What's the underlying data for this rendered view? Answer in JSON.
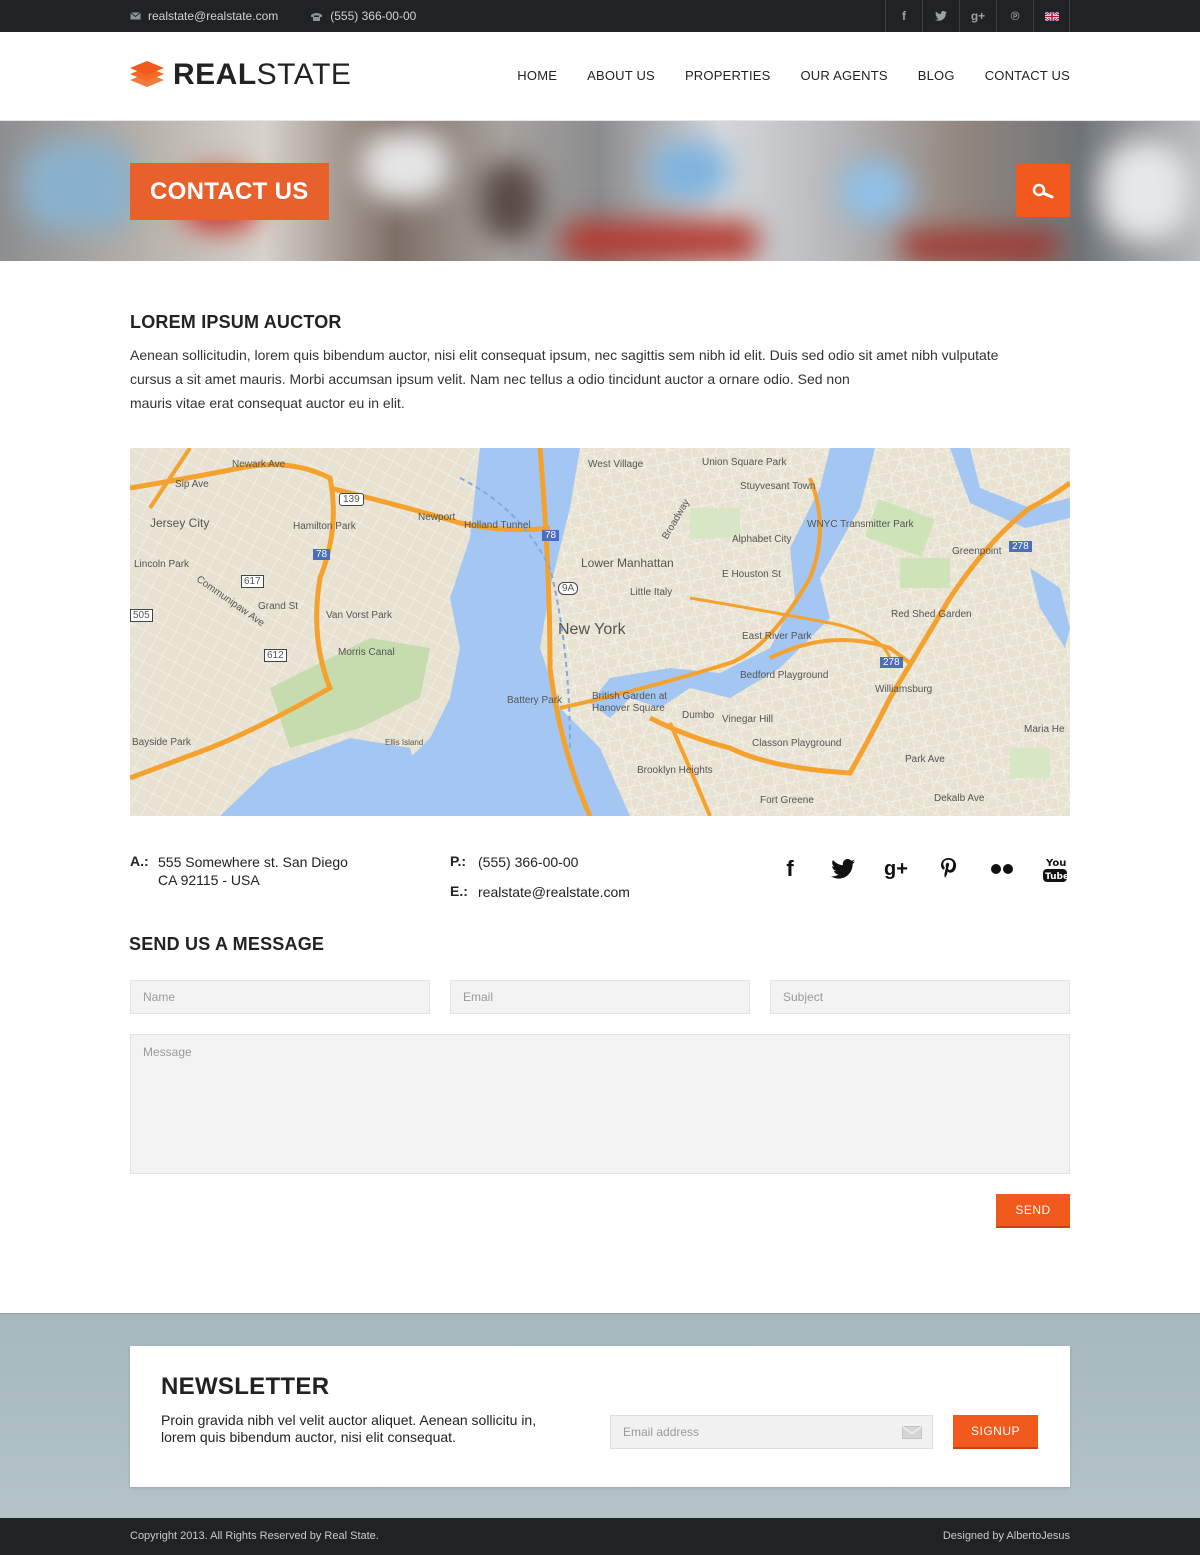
{
  "topbar": {
    "email": "realstate@realstate.com",
    "phone": "(555) 366-00-00",
    "social_icons": [
      "facebook-icon",
      "twitter-icon",
      "google-plus-icon",
      "pinterest-icon",
      "uk-flag-icon"
    ]
  },
  "header": {
    "logo_bold": "REAL",
    "logo_light": "STATE",
    "nav": [
      "HOME",
      "ABOUT US",
      "PROPERTIES",
      "OUR AGENTS",
      "BLOG",
      "CONTACT US"
    ]
  },
  "hero": {
    "title": "CONTACT US"
  },
  "intro": {
    "title": "LOREM IPSUM AUCTOR",
    "text_line1": "Aenean sollicitudin, lorem quis bibendum auctor, nisi elit consequat ipsum, nec sagittis sem nibh id elit. Duis sed odio sit amet nibh vulputate",
    "text_line2": "cursus a sit amet mauris. Morbi accumsan ipsum velit. Nam nec tellus a odio tincidunt auctor a ornare odio. Sed non",
    "text_line3": "mauris vitae erat consequat auctor eu in elit."
  },
  "map": {
    "labels": {
      "new_york": "New York",
      "jersey_city": "Jersey City",
      "lower_manhattan": "Lower Manhattan",
      "union_square": "Union Square Park",
      "west_village": "West Village",
      "stuyvesant": "Stuyvesant Town",
      "wnyc": "WNYC Transmitter Park",
      "alphabet_city": "Alphabet City",
      "greenpoint": "Greenpoint",
      "hamilton_park": "Hamilton Park",
      "newport": "Newport",
      "holland_tunnel": "Holland Tunnel",
      "lincoln_park": "Lincoln Park",
      "van_vorst": "Van Vorst Park",
      "grand_st": "Grand St",
      "morris_canal": "Morris Canal",
      "little_italy": "Little Italy",
      "e_houston": "E Houston St",
      "east_river_park": "East River Park",
      "red_shed": "Red Shed Garden",
      "bedford": "Bedford Playground",
      "williamsburg": "Williamsburg",
      "battery_park": "Battery Park",
      "british_garden": "British Garden at Hanover Square",
      "dumbo": "Dumbo",
      "vinegar_hill": "Vinegar Hill",
      "classon": "Classon Playground",
      "brooklyn_heights": "Brooklyn Heights",
      "fort_greene": "Fort Greene",
      "park_ave": "Park Ave",
      "dekalb": "Dekalb Ave",
      "bayside": "Bayside Park",
      "ellis_island": "Ellis Island",
      "maria_he": "Maria He",
      "sip_ave": "Sip Ave",
      "newark_ave": "Newark Ave",
      "communipaw": "Communipaw Ave",
      "broadway": "Broadway",
      "route_139": "139",
      "route_78a": "78",
      "route_78b": "78",
      "route_9a": "9A",
      "route_617": "617",
      "route_612": "612",
      "route_505": "505",
      "route_278a": "278",
      "route_278b": "278"
    }
  },
  "contact_info": {
    "address_label": "A.:",
    "address_line1": "555 Somewhere st. San Diego",
    "address_line2": "CA 92115 - USA",
    "phone_label": "P.:",
    "phone": "(555) 366-00-00",
    "email_label": "E.:",
    "email": "realstate@realstate.com",
    "social_icons": [
      "facebook-icon",
      "twitter-icon",
      "google-plus-icon",
      "pinterest-icon",
      "flickr-icon",
      "youtube-icon"
    ]
  },
  "message_form": {
    "title": "SEND US A MESSAGE",
    "name_placeholder": "Name",
    "email_placeholder": "Email",
    "subject_placeholder": "Subject",
    "message_placeholder": "Message",
    "send_label": "SEND"
  },
  "newsletter": {
    "title": "NEWSLETTER",
    "text": "Proin gravida nibh vel velit auctor aliquet. Aenean sollicitu in, lorem quis bibendum auctor, nisi elit consequat.",
    "email_placeholder": "Email address",
    "signup_label": "SIGNUP"
  },
  "footer": {
    "copyright": "Copyright 2013. All Rights Reserved by Real State.",
    "credit": "Designed by AlbertoJesus"
  },
  "colors": {
    "accent": "#f2591c",
    "dark_bar": "#1f2326",
    "newsletter_band": "#a7b8bd",
    "water": "#a3c7f2",
    "highway": "#f4a12e"
  }
}
